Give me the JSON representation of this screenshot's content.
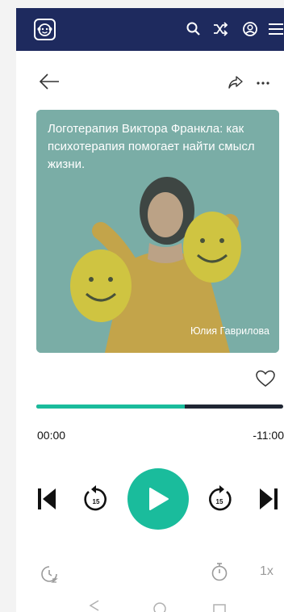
{
  "app": {
    "logo_icon": "monkey-logo-icon",
    "icons": [
      "search-icon",
      "shuffle-icon",
      "profile-icon",
      "menu-icon"
    ]
  },
  "toolbar": {
    "back_icon": "arrow-left-icon",
    "share_icon": "share-icon",
    "more_icon": "more-horizontal-icon"
  },
  "cover": {
    "title": "Логотерапия Виктора Франкла: как психотерапия помогает найти смысл жизни.",
    "author": "Юлия Гаврилова"
  },
  "player": {
    "favorite_icon": "heart-outline-icon",
    "progress_fraction": 0.6,
    "elapsed": "00:00",
    "remaining": "-11:00",
    "rewind_seconds": "15",
    "forward_seconds": "15",
    "speed": "1x",
    "accent_color": "#1abc9c"
  }
}
